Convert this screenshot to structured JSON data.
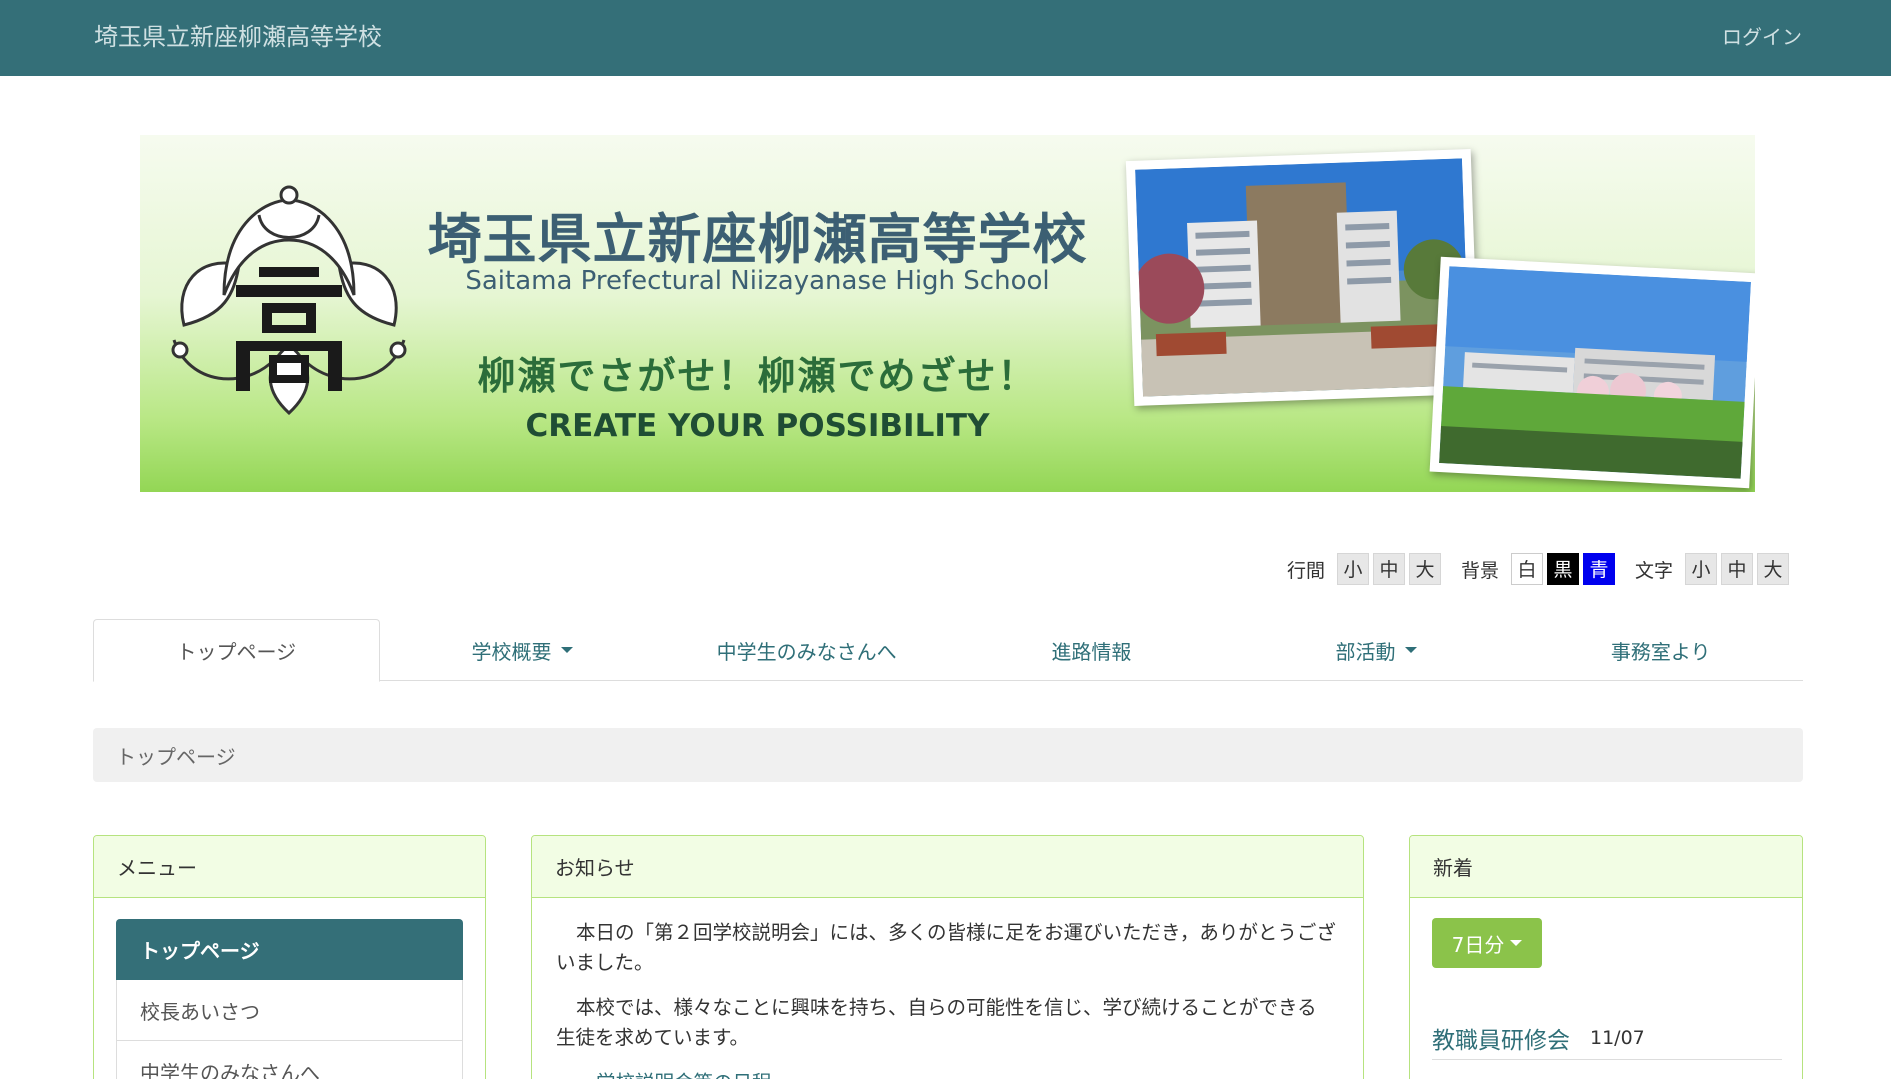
{
  "header": {
    "site_title": "埼玉県立新座柳瀬高等学校",
    "login_label": "ログイン"
  },
  "banner": {
    "title": "埼玉県立新座柳瀬高等学校",
    "subtitle": "Saitama Prefectural Niizayanase High School",
    "slogan": "柳瀬でさがせ！柳瀬でめざせ！",
    "create": "CREATE YOUR POSSIBILITY",
    "crest_char": "高"
  },
  "accessibility": {
    "line_spacing": {
      "label": "行間",
      "options": [
        "小",
        "中",
        "大"
      ]
    },
    "background": {
      "label": "背景",
      "options": [
        "白",
        "黒",
        "青"
      ]
    },
    "text_size": {
      "label": "文字",
      "options": [
        "小",
        "中",
        "大"
      ]
    }
  },
  "tabs": [
    {
      "label": "トップページ",
      "active": true,
      "dropdown": false
    },
    {
      "label": "学校概要",
      "active": false,
      "dropdown": true
    },
    {
      "label": "中学生のみなさんへ",
      "active": false,
      "dropdown": false
    },
    {
      "label": "進路情報",
      "active": false,
      "dropdown": false
    },
    {
      "label": "部活動",
      "active": false,
      "dropdown": true
    },
    {
      "label": "事務室より",
      "active": false,
      "dropdown": false
    }
  ],
  "breadcrumb": {
    "current": "トップページ"
  },
  "menu_panel": {
    "heading": "メニュー",
    "items": [
      "トップページ",
      "校長あいさつ",
      "中学生のみなさんへ"
    ]
  },
  "news_panel": {
    "heading": "お知らせ",
    "paragraph1": "本日の「第２回学校説明会」には、多くの皆様に足をお運びいただき，ありがとうございました。",
    "paragraph2": "本校では、様々なことに興味を持ち、自らの可能性を信じ、学び続けることができる生徒を求めています。",
    "link_text": "学校説明会等の日程"
  },
  "new_panel": {
    "heading": "新着",
    "range_label": "7日分",
    "items": [
      {
        "title": "教職員研修会",
        "date": "11/07"
      }
    ]
  },
  "colors": {
    "navbar": "#346f78",
    "accent": "#2f6f78",
    "panel_border": "#b6e37f",
    "panel_header": "#f2fde4",
    "days_button": "#8bc34a"
  },
  "icons": [
    "caret-down-icon",
    "school-crest-icon"
  ]
}
